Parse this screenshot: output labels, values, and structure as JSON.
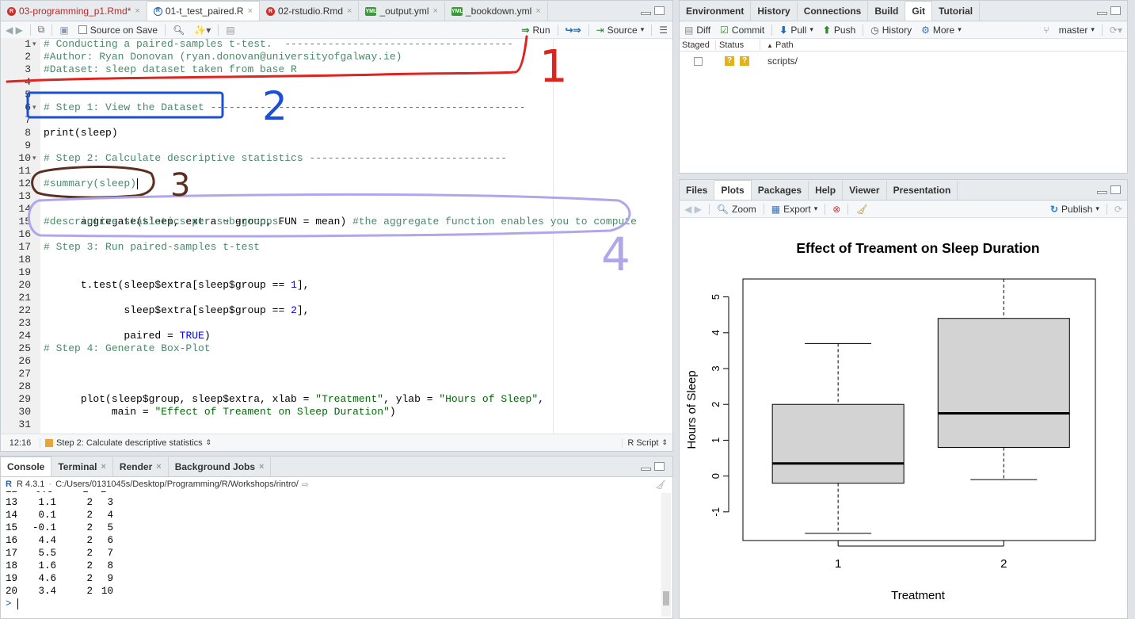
{
  "source": {
    "tabs": [
      {
        "label": "03-programming_p1.Rmd*",
        "icon": "rmd-icon",
        "active": false
      },
      {
        "label": "01-t_test_paired.R",
        "icon": "r-script-icon",
        "active": true
      },
      {
        "label": "02-rstudio.Rmd",
        "icon": "rmd-icon",
        "active": false
      },
      {
        "label": "_output.yml",
        "icon": "yml-icon",
        "active": false
      },
      {
        "label": "_bookdown.yml",
        "icon": "yml-icon",
        "active": false
      }
    ],
    "toolbar": {
      "source_on_save": "Source on Save",
      "run": "Run",
      "source": "Source"
    },
    "line_numbers": [
      "1",
      "2",
      "3",
      "4",
      "5",
      "6",
      "7",
      "8",
      "9",
      "10",
      "11",
      "12",
      "13",
      "14",
      "15",
      "16",
      "17",
      "18",
      "19",
      "20",
      "21",
      "22",
      "23",
      "24",
      "25",
      "26",
      "27",
      "28",
      "29",
      "30",
      "31"
    ],
    "lines": {
      "l1": "# Conducting a paired-samples t-test.  -------------------------------------",
      "l2": "#Author: Ryan Donovan (ryan.donovan@universityofgalway.ie)",
      "l3": "#Dataset: sleep dataset taken from base R",
      "l6": "# Step 1: View the Dataset ---------------------------------------------------",
      "l8": "print(sleep)",
      "l10": "# Step 2: Calculate descriptive statistics --------------------------------",
      "l12": "#summary(sleep)",
      "l14a": "aggregate(sleep, extra ~ group, FUN = mean) ",
      "l14b": "#the aggregate function enables you to compute",
      "l15": "#descriptive statistics per sub-groups.",
      "l17": "# Step 3: Run paired-samples t-test",
      "l19": "t.test(sleep$extra[sleep$group == ",
      "l19n": "1",
      "l19e": "],",
      "l21": "       sleep$extra[sleep$group == ",
      "l21n": "2",
      "l21e": "],",
      "l23a": "       paired = ",
      "l23b": "TRUE",
      "l23c": ")",
      "l25": "# Step 4: Generate Box-Plot",
      "l28a": "plot(sleep$group, sleep$extra, xlab = ",
      "l28s1": "\"Treatment\"",
      "l28m": ", ylab = ",
      "l28s2": "\"Hours of Sleep\"",
      "l28e": ",",
      "l29a": "     main = ",
      "l29s": "\"Effect of Treament on Sleep Duration\"",
      "l29e": ")"
    },
    "annotations": [
      "1",
      "2",
      "3",
      "4"
    ],
    "status": {
      "position": "12:16",
      "section": "Step 2: Calculate descriptive statistics",
      "filetype": "R Script"
    }
  },
  "console": {
    "tabs": [
      {
        "label": "Console",
        "active": true
      },
      {
        "label": "Terminal",
        "active": false
      },
      {
        "label": "Render",
        "active": false
      },
      {
        "label": "Background Jobs",
        "active": false
      }
    ],
    "version": "R 4.3.1",
    "path": "C:/Users/0131045s/Desktop/Programming/R/Workshops/rintro/",
    "rows": [
      {
        "idx": "13",
        "extra": "1.1",
        "group": "2",
        "id": "3"
      },
      {
        "idx": "14",
        "extra": "0.1",
        "group": "2",
        "id": "4"
      },
      {
        "idx": "15",
        "extra": "-0.1",
        "group": "2",
        "id": "5"
      },
      {
        "idx": "16",
        "extra": "4.4",
        "group": "2",
        "id": "6"
      },
      {
        "idx": "17",
        "extra": "5.5",
        "group": "2",
        "id": "7"
      },
      {
        "idx": "18",
        "extra": "1.6",
        "group": "2",
        "id": "8"
      },
      {
        "idx": "19",
        "extra": "4.6",
        "group": "2",
        "id": "9"
      },
      {
        "idx": "20",
        "extra": "3.4",
        "group": "2",
        "id": "10"
      }
    ],
    "prompt": ">"
  },
  "env": {
    "tabs": [
      {
        "label": "Environment",
        "active": false
      },
      {
        "label": "History",
        "active": false
      },
      {
        "label": "Connections",
        "active": false
      },
      {
        "label": "Build",
        "active": false
      },
      {
        "label": "Git",
        "active": true
      },
      {
        "label": "Tutorial",
        "active": false
      }
    ],
    "toolbar": {
      "diff": "Diff",
      "commit": "Commit",
      "pull": "Pull",
      "push": "Push",
      "history": "History",
      "more": "More",
      "branch": "master"
    },
    "columns": {
      "staged": "Staged",
      "status": "Status",
      "path": "Path"
    },
    "files": [
      {
        "status": "?",
        "path": "scripts/"
      }
    ]
  },
  "plots": {
    "tabs": [
      {
        "label": "Files",
        "active": false
      },
      {
        "label": "Plots",
        "active": true
      },
      {
        "label": "Packages",
        "active": false
      },
      {
        "label": "Help",
        "active": false
      },
      {
        "label": "Viewer",
        "active": false
      },
      {
        "label": "Presentation",
        "active": false
      }
    ],
    "toolbar": {
      "zoom": "Zoom",
      "export": "Export",
      "publish": "Publish"
    }
  },
  "chart_data": {
    "type": "boxplot",
    "title": "Effect of Treament on Sleep Duration",
    "xlabel": "Treatment",
    "ylabel": "Hours of Sleep",
    "categories": [
      "1",
      "2"
    ],
    "boxes": [
      {
        "name": "1",
        "min": -1.6,
        "q1": -0.2,
        "median": 0.35,
        "q3": 2.0,
        "max": 3.7
      },
      {
        "name": "2",
        "min": -0.1,
        "q1": 0.8,
        "median": 1.75,
        "q3": 4.4,
        "max": 5.5
      }
    ],
    "yticks": [
      "-1",
      "0",
      "1",
      "2",
      "3",
      "4",
      "5"
    ],
    "ylim": [
      -1.8,
      5.5
    ],
    "box_fill": "#d3d3d3"
  },
  "colors": {
    "annotation_red": "#e0231e",
    "annotation_blue": "#1a4fd6",
    "annotation_brown": "#5a2f22",
    "annotation_purple": "#b1a6ea"
  }
}
